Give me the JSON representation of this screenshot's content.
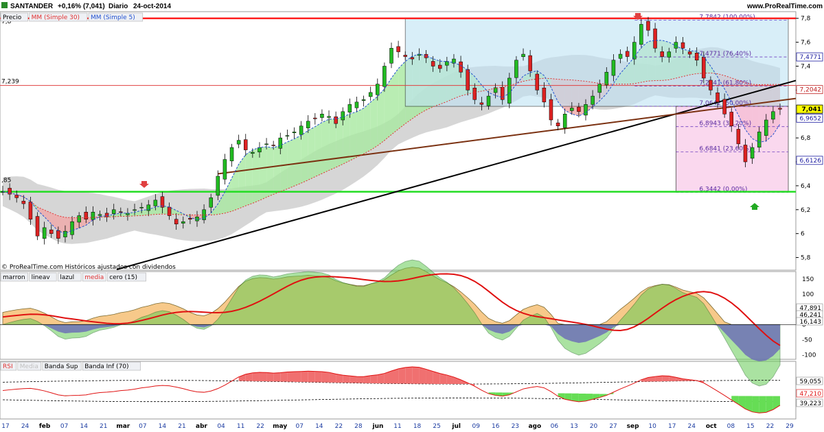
{
  "header": {
    "symbol": "SANTANDER",
    "change": "+0,16% (7,041)",
    "period": "Diario",
    "date": "24-oct-2014",
    "site": "www.ProRealTime.com",
    "legend_price": [
      "Precio",
      "MM (Simple 30)",
      "MM (Simple 5)"
    ],
    "legend_price_colors": [
      "#000000",
      "#e03030",
      "#2050d0"
    ],
    "watermark": "© ProRealTime.com Históricos ajustados con dividendos"
  },
  "panel2": {
    "legend": [
      "marron",
      "lineav",
      "lazul",
      "media",
      "cero (15)"
    ],
    "legend_colors": [
      "#000000",
      "#000000",
      "#000000",
      "#e03030",
      "#000000"
    ],
    "axis_ticks": [
      "150",
      "100",
      "50",
      "0",
      "-50",
      "-100"
    ],
    "badges": [
      "47,891",
      "46,241",
      "16,143"
    ]
  },
  "panel3": {
    "legend": [
      "RSI",
      "Media",
      "Banda Sup",
      "Banda Inf (70)"
    ],
    "legend_colors": [
      "#e03030",
      "#c0c0c0",
      "#000000",
      "#000000"
    ],
    "badges": [
      "59,055",
      "47,210",
      "39,223"
    ]
  },
  "price_axis": {
    "ticks": [
      "7,8",
      "7,6",
      "7,4",
      "7,2",
      "7",
      "6,8",
      "6,6",
      "6,4",
      "6,2",
      "6",
      "5,8"
    ],
    "badges": [
      {
        "text": "7,4771",
        "color": "#1a1aa0"
      },
      {
        "text": "7,2042",
        "color": "#c02020"
      },
      {
        "text": "7,041",
        "color": "#000000",
        "bg": "#ffff00"
      },
      {
        "text": "6,9652",
        "color": "#1a1aa0"
      },
      {
        "text": "6,6126",
        "color": "#1a1aa0"
      }
    ],
    "left_labels": [
      "7,239",
      ",85",
      "7,8"
    ]
  },
  "fibo": [
    {
      "label": "7,7842 (100,00%)"
    },
    {
      "label": "7,4771 (76,40%)"
    },
    {
      "label": "7,2341 (61,80%)"
    },
    {
      "label": "7,0642 (50,00%)"
    },
    {
      "label": "6,8943 (38,20%)"
    },
    {
      "label": "6,6841 (23,60%)"
    },
    {
      "label": "6,3442 (0,00%)"
    }
  ],
  "x_axis": {
    "labels": [
      "17",
      "24",
      "feb",
      "07",
      "14",
      "21",
      "mar",
      "07",
      "14",
      "21",
      "abr",
      "04",
      "11",
      "22",
      "may",
      "07",
      "14",
      "22",
      "28",
      "jun",
      "11",
      "18",
      "25",
      "jul",
      "09",
      "16",
      "23",
      "ago",
      "06",
      "13",
      "20",
      "27",
      "sep",
      "10",
      "17",
      "24",
      "oct",
      "08",
      "15",
      "22",
      "29"
    ]
  },
  "chart_data": {
    "type": "candlestick",
    "x_range": [
      "17-ene-2014",
      "29-oct-2014"
    ],
    "ylim": [
      5.7,
      7.85
    ],
    "grid": false,
    "horizontal_levels": [
      {
        "name": "red",
        "value": 7.8,
        "color": "#ff2020"
      },
      {
        "name": "green",
        "value": 6.35,
        "color": "#22dd22"
      },
      {
        "name": "pink",
        "value": 7.239,
        "color": "#e04040"
      }
    ],
    "fibonacci": {
      "high": 7.7842,
      "low": 6.3442,
      "levels": [
        7.7842,
        7.4771,
        7.2341,
        7.0642,
        6.8943,
        6.6841,
        6.3442
      ]
    },
    "price_series": {
      "name": "Precio",
      "points": [
        [
          0,
          6.35
        ],
        [
          1,
          6.33
        ],
        [
          2,
          6.3
        ],
        [
          3,
          6.25
        ],
        [
          4,
          6.12
        ],
        [
          5,
          5.98
        ],
        [
          6,
          6.05
        ],
        [
          7,
          6.0
        ],
        [
          8,
          5.96
        ],
        [
          9,
          6.02
        ],
        [
          10,
          6.1
        ],
        [
          11,
          6.15
        ],
        [
          12,
          6.12
        ],
        [
          13,
          6.18
        ],
        [
          14,
          6.16
        ],
        [
          15,
          6.14
        ],
        [
          16,
          6.2
        ],
        [
          17,
          6.18
        ],
        [
          18,
          6.17
        ],
        [
          19,
          6.2
        ],
        [
          20,
          6.22
        ],
        [
          21,
          6.24
        ],
        [
          22,
          6.28
        ],
        [
          23,
          6.22
        ],
        [
          24,
          6.15
        ],
        [
          25,
          6.08
        ],
        [
          26,
          6.1
        ],
        [
          27,
          6.12
        ],
        [
          28,
          6.14
        ],
        [
          29,
          6.2
        ],
        [
          30,
          6.3
        ],
        [
          31,
          6.48
        ],
        [
          32,
          6.62
        ],
        [
          33,
          6.72
        ],
        [
          34,
          6.78
        ],
        [
          35,
          6.7
        ],
        [
          36,
          6.68
        ],
        [
          37,
          6.72
        ],
        [
          38,
          6.75
        ],
        [
          39,
          6.74
        ],
        [
          40,
          6.8
        ],
        [
          41,
          6.82
        ],
        [
          42,
          6.85
        ],
        [
          43,
          6.9
        ],
        [
          44,
          6.94
        ],
        [
          45,
          6.96
        ],
        [
          46,
          7.0
        ],
        [
          47,
          6.98
        ],
        [
          48,
          6.92
        ],
        [
          49,
          7.02
        ],
        [
          50,
          7.08
        ],
        [
          51,
          7.1
        ],
        [
          52,
          7.12
        ],
        [
          53,
          7.18
        ],
        [
          54,
          7.25
        ],
        [
          55,
          7.4
        ],
        [
          56,
          7.55
        ],
        [
          57,
          7.52
        ],
        [
          58,
          7.48
        ],
        [
          59,
          7.46
        ],
        [
          60,
          7.5
        ],
        [
          61,
          7.47
        ],
        [
          62,
          7.4
        ],
        [
          63,
          7.38
        ],
        [
          64,
          7.44
        ],
        [
          65,
          7.46
        ],
        [
          66,
          7.35
        ],
        [
          67,
          7.2
        ],
        [
          68,
          7.12
        ],
        [
          69,
          7.08
        ],
        [
          70,
          7.15
        ],
        [
          71,
          7.22
        ],
        [
          72,
          7.12
        ],
        [
          73,
          7.3
        ],
        [
          74,
          7.45
        ],
        [
          75,
          7.5
        ],
        [
          76,
          7.36
        ],
        [
          77,
          7.2
        ],
        [
          78,
          7.1
        ],
        [
          79,
          6.95
        ],
        [
          80,
          6.9
        ],
        [
          81,
          7.0
        ],
        [
          82,
          7.05
        ],
        [
          83,
          7.02
        ],
        [
          84,
          7.08
        ],
        [
          85,
          7.15
        ],
        [
          86,
          7.25
        ],
        [
          87,
          7.35
        ],
        [
          88,
          7.45
        ],
        [
          89,
          7.5
        ],
        [
          90,
          7.48
        ],
        [
          91,
          7.6
        ],
        [
          92,
          7.75
        ],
        [
          93,
          7.7
        ],
        [
          94,
          7.55
        ],
        [
          95,
          7.48
        ],
        [
          96,
          7.52
        ],
        [
          97,
          7.6
        ],
        [
          98,
          7.55
        ],
        [
          99,
          7.5
        ],
        [
          100,
          7.45
        ],
        [
          101,
          7.3
        ],
        [
          102,
          7.2
        ],
        [
          103,
          7.1
        ],
        [
          104,
          7.0
        ],
        [
          105,
          6.9
        ],
        [
          106,
          6.75
        ],
        [
          107,
          6.6
        ],
        [
          108,
          6.72
        ],
        [
          109,
          6.85
        ],
        [
          110,
          6.95
        ],
        [
          111,
          7.02
        ],
        [
          112,
          7.04
        ]
      ]
    },
    "sma5": {
      "name": "MM (Simple 5)"
    },
    "sma30": {
      "name": "MM (Simple 30)"
    },
    "oscillator": {
      "ylim": [
        -110,
        170
      ],
      "levels": [
        0
      ]
    },
    "rsi": {
      "ylim": [
        20,
        80
      ],
      "upper": 59.055,
      "lower": 39.223,
      "last": 47.21
    }
  }
}
